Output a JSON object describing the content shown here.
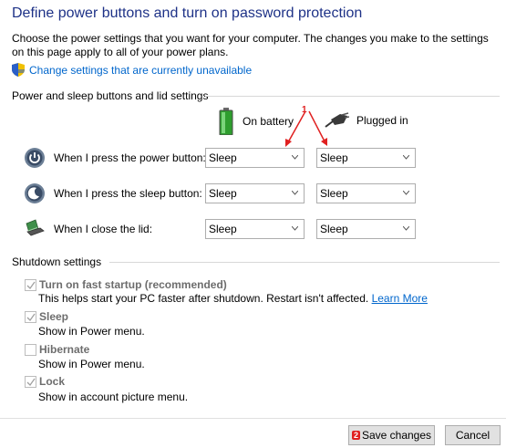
{
  "header": {
    "title": "Define power buttons and turn on password protection",
    "description": "Choose the power settings that you want for your computer. The changes you make to the settings on this page apply to all of your power plans.",
    "change_settings_link": "Change settings that are currently unavailable"
  },
  "power_group": {
    "title": "Power and sleep buttons and lid settings",
    "col_battery": "On battery",
    "col_plugged": "Plugged in",
    "annotation_1": "1",
    "rows": [
      {
        "label": "When I press the power button:",
        "battery": "Sleep",
        "plugged": "Sleep"
      },
      {
        "label": "When I press the sleep button:",
        "battery": "Sleep",
        "plugged": "Sleep"
      },
      {
        "label": "When I close the lid:",
        "battery": "Sleep",
        "plugged": "Sleep"
      }
    ]
  },
  "shutdown_group": {
    "title": "Shutdown settings",
    "items": [
      {
        "label": "Turn on fast startup (recommended)",
        "desc": "This helps start your PC faster after shutdown. Restart isn't affected.",
        "link": "Learn More",
        "checked": true
      },
      {
        "label": "Sleep",
        "desc": "Show in Power menu.",
        "checked": true
      },
      {
        "label": "Hibernate",
        "desc": "Show in Power menu.",
        "checked": false
      },
      {
        "label": "Lock",
        "desc": "Show in account picture menu.",
        "checked": true
      }
    ]
  },
  "footer": {
    "annotation_2": "2",
    "save_label": "Save changes",
    "cancel_label": "Cancel"
  },
  "colors": {
    "title": "#1e3287",
    "link": "#0066cc",
    "annotation": "#e02020"
  }
}
